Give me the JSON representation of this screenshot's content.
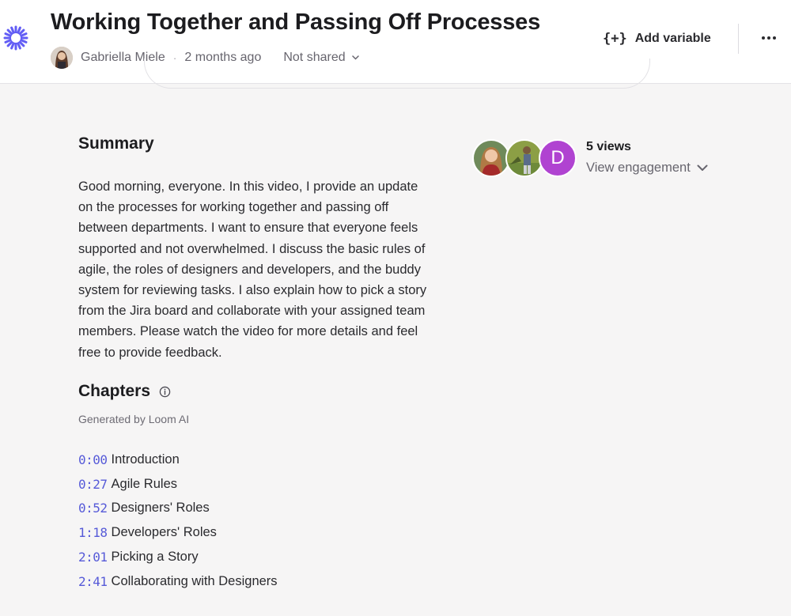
{
  "header": {
    "title": "Working Together and Passing Off Processes",
    "author": "Gabriella Miele",
    "separator": "·",
    "time_ago": "2 months ago",
    "share_status": "Not shared",
    "add_variable_icon": "{+}",
    "add_variable_label": "Add variable"
  },
  "summary": {
    "heading": "Summary",
    "text": "Good morning, everyone. In this video, I provide an update on the processes for working together and passing off between departments. I want to ensure that everyone feels supported and not overwhelmed. I discuss the basic rules of agile, the roles of designers and developers, and the buddy system for reviewing tasks. I also explain how to pick a story from the Jira board and collaborate with your assigned team members. Please watch the video for more details and feel free to provide feedback."
  },
  "chapters": {
    "heading": "Chapters",
    "generated_by": "Generated by Loom AI",
    "items": [
      {
        "time": "0:00",
        "title": "Introduction"
      },
      {
        "time": "0:27",
        "title": "Agile Rules"
      },
      {
        "time": "0:52",
        "title": "Designers' Roles"
      },
      {
        "time": "1:18",
        "title": "Developers' Roles"
      },
      {
        "time": "2:01",
        "title": "Picking a Story"
      },
      {
        "time": "2:41",
        "title": "Collaborating with Designers"
      }
    ]
  },
  "engagement": {
    "views": "5 views",
    "view_engagement_label": "View engagement",
    "viewer_initial": "D"
  },
  "colors": {
    "accent": "#565ad8",
    "logo": "#625df5",
    "viewer_d": "#b043d1"
  },
  "icons": [
    "loom-logo-icon",
    "add-variable-icon",
    "chevron-down-icon",
    "more-options-icon",
    "info-icon"
  ]
}
